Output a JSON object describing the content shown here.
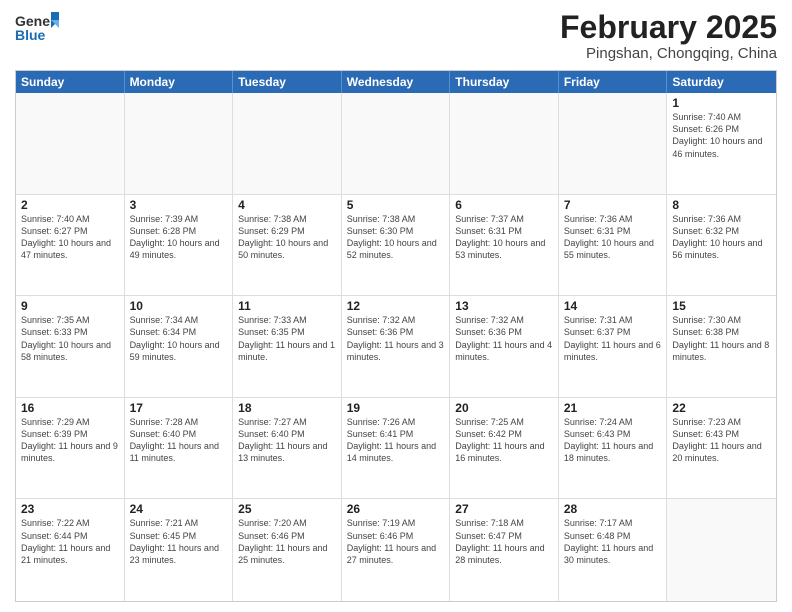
{
  "header": {
    "logo_general": "General",
    "logo_blue": "Blue",
    "title": "February 2025",
    "subtitle": "Pingshan, Chongqing, China"
  },
  "days_of_week": [
    "Sunday",
    "Monday",
    "Tuesday",
    "Wednesday",
    "Thursday",
    "Friday",
    "Saturday"
  ],
  "weeks": [
    [
      {
        "day": "",
        "info": ""
      },
      {
        "day": "",
        "info": ""
      },
      {
        "day": "",
        "info": ""
      },
      {
        "day": "",
        "info": ""
      },
      {
        "day": "",
        "info": ""
      },
      {
        "day": "",
        "info": ""
      },
      {
        "day": "1",
        "info": "Sunrise: 7:40 AM\nSunset: 6:26 PM\nDaylight: 10 hours and 46 minutes."
      }
    ],
    [
      {
        "day": "2",
        "info": "Sunrise: 7:40 AM\nSunset: 6:27 PM\nDaylight: 10 hours and 47 minutes."
      },
      {
        "day": "3",
        "info": "Sunrise: 7:39 AM\nSunset: 6:28 PM\nDaylight: 10 hours and 49 minutes."
      },
      {
        "day": "4",
        "info": "Sunrise: 7:38 AM\nSunset: 6:29 PM\nDaylight: 10 hours and 50 minutes."
      },
      {
        "day": "5",
        "info": "Sunrise: 7:38 AM\nSunset: 6:30 PM\nDaylight: 10 hours and 52 minutes."
      },
      {
        "day": "6",
        "info": "Sunrise: 7:37 AM\nSunset: 6:31 PM\nDaylight: 10 hours and 53 minutes."
      },
      {
        "day": "7",
        "info": "Sunrise: 7:36 AM\nSunset: 6:31 PM\nDaylight: 10 hours and 55 minutes."
      },
      {
        "day": "8",
        "info": "Sunrise: 7:36 AM\nSunset: 6:32 PM\nDaylight: 10 hours and 56 minutes."
      }
    ],
    [
      {
        "day": "9",
        "info": "Sunrise: 7:35 AM\nSunset: 6:33 PM\nDaylight: 10 hours and 58 minutes."
      },
      {
        "day": "10",
        "info": "Sunrise: 7:34 AM\nSunset: 6:34 PM\nDaylight: 10 hours and 59 minutes."
      },
      {
        "day": "11",
        "info": "Sunrise: 7:33 AM\nSunset: 6:35 PM\nDaylight: 11 hours and 1 minute."
      },
      {
        "day": "12",
        "info": "Sunrise: 7:32 AM\nSunset: 6:36 PM\nDaylight: 11 hours and 3 minutes."
      },
      {
        "day": "13",
        "info": "Sunrise: 7:32 AM\nSunset: 6:36 PM\nDaylight: 11 hours and 4 minutes."
      },
      {
        "day": "14",
        "info": "Sunrise: 7:31 AM\nSunset: 6:37 PM\nDaylight: 11 hours and 6 minutes."
      },
      {
        "day": "15",
        "info": "Sunrise: 7:30 AM\nSunset: 6:38 PM\nDaylight: 11 hours and 8 minutes."
      }
    ],
    [
      {
        "day": "16",
        "info": "Sunrise: 7:29 AM\nSunset: 6:39 PM\nDaylight: 11 hours and 9 minutes."
      },
      {
        "day": "17",
        "info": "Sunrise: 7:28 AM\nSunset: 6:40 PM\nDaylight: 11 hours and 11 minutes."
      },
      {
        "day": "18",
        "info": "Sunrise: 7:27 AM\nSunset: 6:40 PM\nDaylight: 11 hours and 13 minutes."
      },
      {
        "day": "19",
        "info": "Sunrise: 7:26 AM\nSunset: 6:41 PM\nDaylight: 11 hours and 14 minutes."
      },
      {
        "day": "20",
        "info": "Sunrise: 7:25 AM\nSunset: 6:42 PM\nDaylight: 11 hours and 16 minutes."
      },
      {
        "day": "21",
        "info": "Sunrise: 7:24 AM\nSunset: 6:43 PM\nDaylight: 11 hours and 18 minutes."
      },
      {
        "day": "22",
        "info": "Sunrise: 7:23 AM\nSunset: 6:43 PM\nDaylight: 11 hours and 20 minutes."
      }
    ],
    [
      {
        "day": "23",
        "info": "Sunrise: 7:22 AM\nSunset: 6:44 PM\nDaylight: 11 hours and 21 minutes."
      },
      {
        "day": "24",
        "info": "Sunrise: 7:21 AM\nSunset: 6:45 PM\nDaylight: 11 hours and 23 minutes."
      },
      {
        "day": "25",
        "info": "Sunrise: 7:20 AM\nSunset: 6:46 PM\nDaylight: 11 hours and 25 minutes."
      },
      {
        "day": "26",
        "info": "Sunrise: 7:19 AM\nSunset: 6:46 PM\nDaylight: 11 hours and 27 minutes."
      },
      {
        "day": "27",
        "info": "Sunrise: 7:18 AM\nSunset: 6:47 PM\nDaylight: 11 hours and 28 minutes."
      },
      {
        "day": "28",
        "info": "Sunrise: 7:17 AM\nSunset: 6:48 PM\nDaylight: 11 hours and 30 minutes."
      },
      {
        "day": "",
        "info": ""
      }
    ]
  ]
}
